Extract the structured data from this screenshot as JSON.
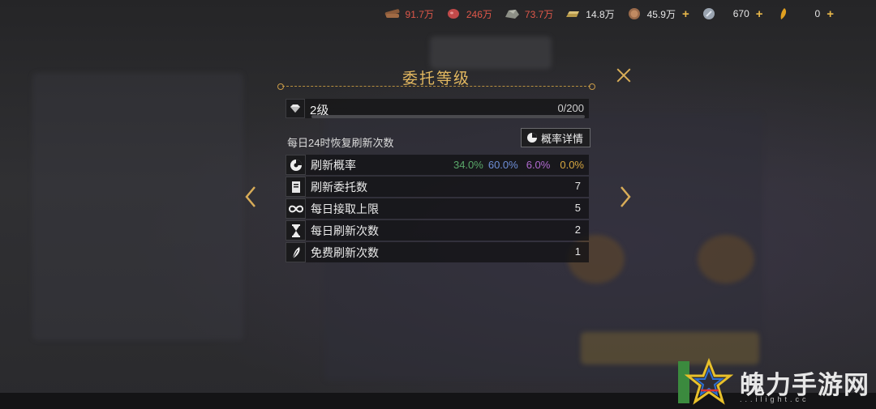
{
  "resources": [
    {
      "icon": "wood-icon",
      "value": "91.7万",
      "color": "red"
    },
    {
      "icon": "meat-icon",
      "value": "246万",
      "color": "red"
    },
    {
      "icon": "stone-icon",
      "value": "73.7万",
      "color": "red"
    },
    {
      "icon": "iron-icon",
      "value": "14.8万",
      "color": "white"
    },
    {
      "icon": "coin-icon",
      "value": "45.9万",
      "color": "white",
      "plus": "+"
    },
    {
      "icon": "silver-icon",
      "value": "670",
      "color": "white",
      "plus": "+"
    },
    {
      "icon": "feather-gem-icon",
      "value": "0",
      "color": "white",
      "plus": "+"
    }
  ],
  "dialog": {
    "title": "委托等级",
    "level": "2级",
    "progress": "0/200",
    "progress_fraction": 0,
    "daily_label": "每日24时恢复刷新次数",
    "prob_button": "概率详情"
  },
  "stats": [
    {
      "icon": "pie-chart-icon",
      "label": "刷新概率"
    },
    {
      "icon": "scroll-icon",
      "label": "刷新委托数",
      "value": "7"
    },
    {
      "icon": "infinity-icon",
      "label": "每日接取上限",
      "value": "5"
    },
    {
      "icon": "hourglass-icon",
      "label": "每日刷新次数",
      "value": "2"
    },
    {
      "icon": "feather-icon",
      "label": "免费刷新次数",
      "value": "1"
    }
  ],
  "probabilities": [
    {
      "value": "34.0%",
      "color": "#5aa86a"
    },
    {
      "value": "60.0%",
      "color": "#6e8fd8"
    },
    {
      "value": "6.0%",
      "color": "#b06ad0"
    },
    {
      "value": "0.0%",
      "color": "#d8a840"
    }
  ],
  "watermark": {
    "text": "魄力手游网",
    "sub": "...ilight.cc"
  }
}
